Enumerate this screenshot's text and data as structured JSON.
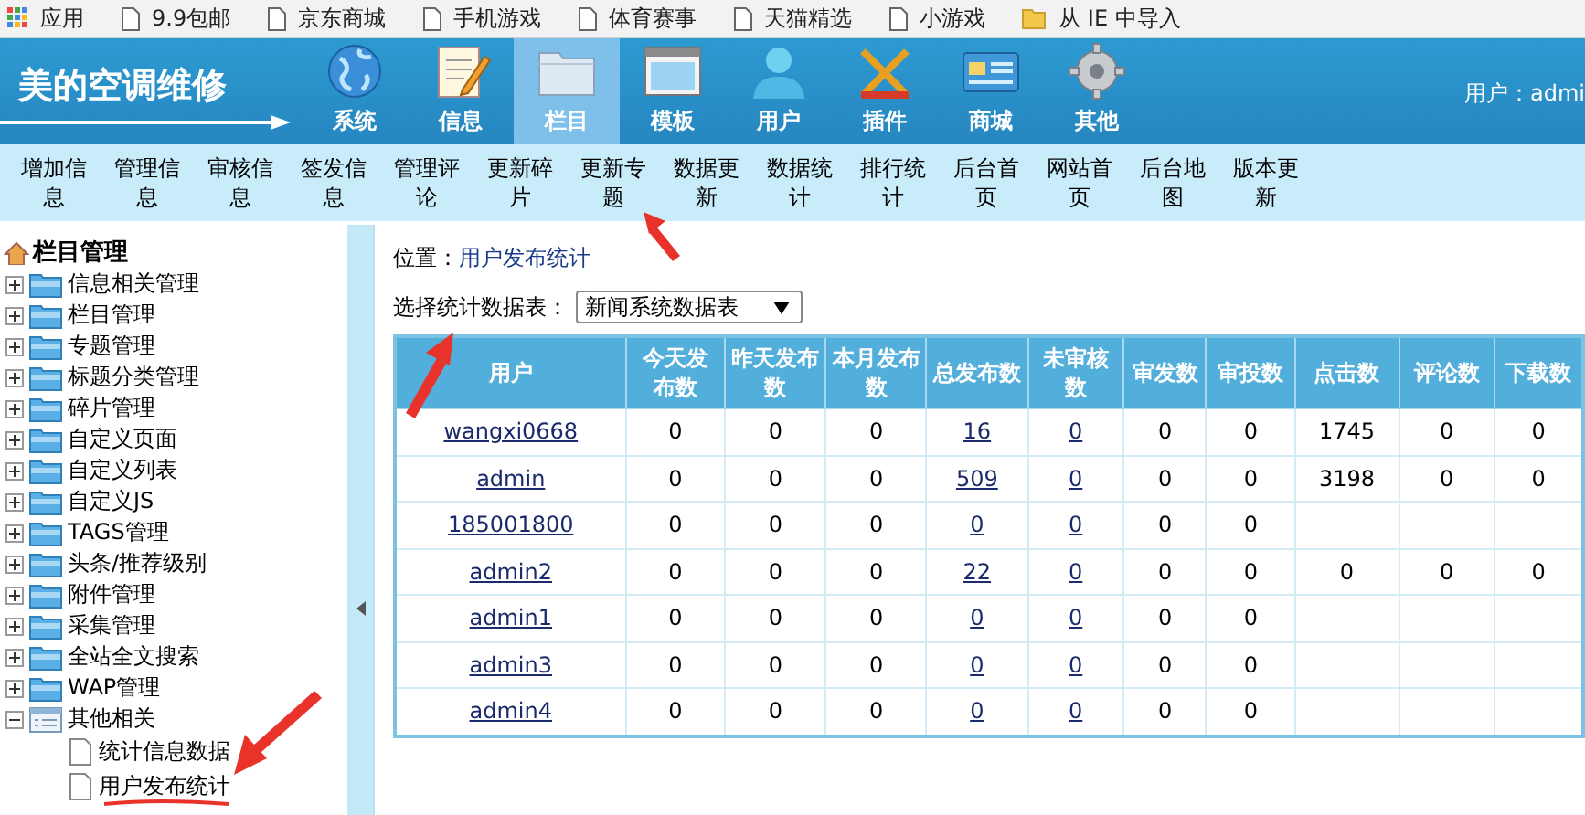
{
  "bookmarks": [
    {
      "kind": "apps",
      "label": "应用"
    },
    {
      "kind": "page",
      "label": "9.9包邮"
    },
    {
      "kind": "page",
      "label": "京东商城"
    },
    {
      "kind": "page",
      "label": "手机游戏"
    },
    {
      "kind": "page",
      "label": "体育赛事"
    },
    {
      "kind": "page",
      "label": "天猫精选"
    },
    {
      "kind": "page",
      "label": "小游戏"
    },
    {
      "kind": "folder",
      "label": "从 IE 中导入"
    }
  ],
  "header": {
    "logo": "美的空调维修",
    "user": "用户：admi",
    "nav": [
      {
        "label": "系统",
        "selected": false
      },
      {
        "label": "信息",
        "selected": false
      },
      {
        "label": "栏目",
        "selected": true
      },
      {
        "label": "模板",
        "selected": false
      },
      {
        "label": "用户",
        "selected": false
      },
      {
        "label": "插件",
        "selected": false
      },
      {
        "label": "商城",
        "selected": false
      },
      {
        "label": "其他",
        "selected": false
      }
    ]
  },
  "toolbar": [
    "增加信息",
    "管理信息",
    "审核信息",
    "签发信息",
    "管理评论",
    "更新碎片",
    "更新专题",
    "数据更新",
    "数据统计",
    "排行统计",
    "后台首页",
    "网站首页",
    "后台地图",
    "版本更新"
  ],
  "sidebar": {
    "title": "栏目管理",
    "items": [
      {
        "label": "信息相关管理",
        "expanded": false
      },
      {
        "label": "栏目管理",
        "expanded": false
      },
      {
        "label": "专题管理",
        "expanded": false
      },
      {
        "label": "标题分类管理",
        "expanded": false
      },
      {
        "label": "碎片管理",
        "expanded": false
      },
      {
        "label": "自定义页面",
        "expanded": false
      },
      {
        "label": "自定义列表",
        "expanded": false
      },
      {
        "label": "自定义JS",
        "expanded": false
      },
      {
        "label": "TAGS管理",
        "expanded": false
      },
      {
        "label": "头条/推荐级别",
        "expanded": false
      },
      {
        "label": "附件管理",
        "expanded": false
      },
      {
        "label": "采集管理",
        "expanded": false
      },
      {
        "label": "全站全文搜索",
        "expanded": false
      },
      {
        "label": "WAP管理",
        "expanded": false
      },
      {
        "label": "其他相关",
        "expanded": true,
        "children": [
          {
            "label": "统计信息数据"
          },
          {
            "label": "用户发布统计"
          }
        ]
      }
    ]
  },
  "breadcrumb": {
    "label": "位置：",
    "link": "用户发布统计"
  },
  "table_select": {
    "label": "选择统计数据表：",
    "value": "新闻系统数据表"
  },
  "table": {
    "columns": [
      {
        "label": "用户",
        "kind": "link"
      },
      {
        "label": "今天发布数",
        "kind": "text"
      },
      {
        "label": "昨天发布数",
        "kind": "text"
      },
      {
        "label": "本月发布数",
        "kind": "text"
      },
      {
        "label": "总发布数",
        "kind": "link"
      },
      {
        "label": "未审核数",
        "kind": "link"
      },
      {
        "label": "审发数",
        "kind": "text"
      },
      {
        "label": "审投数",
        "kind": "text"
      },
      {
        "label": "点击数",
        "kind": "text"
      },
      {
        "label": "评论数",
        "kind": "text"
      },
      {
        "label": "下载数",
        "kind": "text"
      }
    ],
    "rows": [
      [
        "wangxi0668",
        "0",
        "0",
        "0",
        "16",
        "0",
        "0",
        "0",
        "1745",
        "0",
        "0"
      ],
      [
        "admin",
        "0",
        "0",
        "0",
        "509",
        "0",
        "0",
        "0",
        "3198",
        "0",
        "0"
      ],
      [
        "185001800",
        "0",
        "0",
        "0",
        "0",
        "0",
        "0",
        "0"
      ],
      [
        "admin2",
        "0",
        "0",
        "0",
        "22",
        "0",
        "0",
        "0",
        "0",
        "0",
        "0"
      ],
      [
        "admin1",
        "0",
        "0",
        "0",
        "0",
        "0",
        "0",
        "0"
      ],
      [
        "admin3",
        "0",
        "0",
        "0",
        "0",
        "0",
        "0",
        "0"
      ],
      [
        "admin4",
        "0",
        "0",
        "0",
        "0",
        "0",
        "0",
        "0"
      ]
    ]
  }
}
